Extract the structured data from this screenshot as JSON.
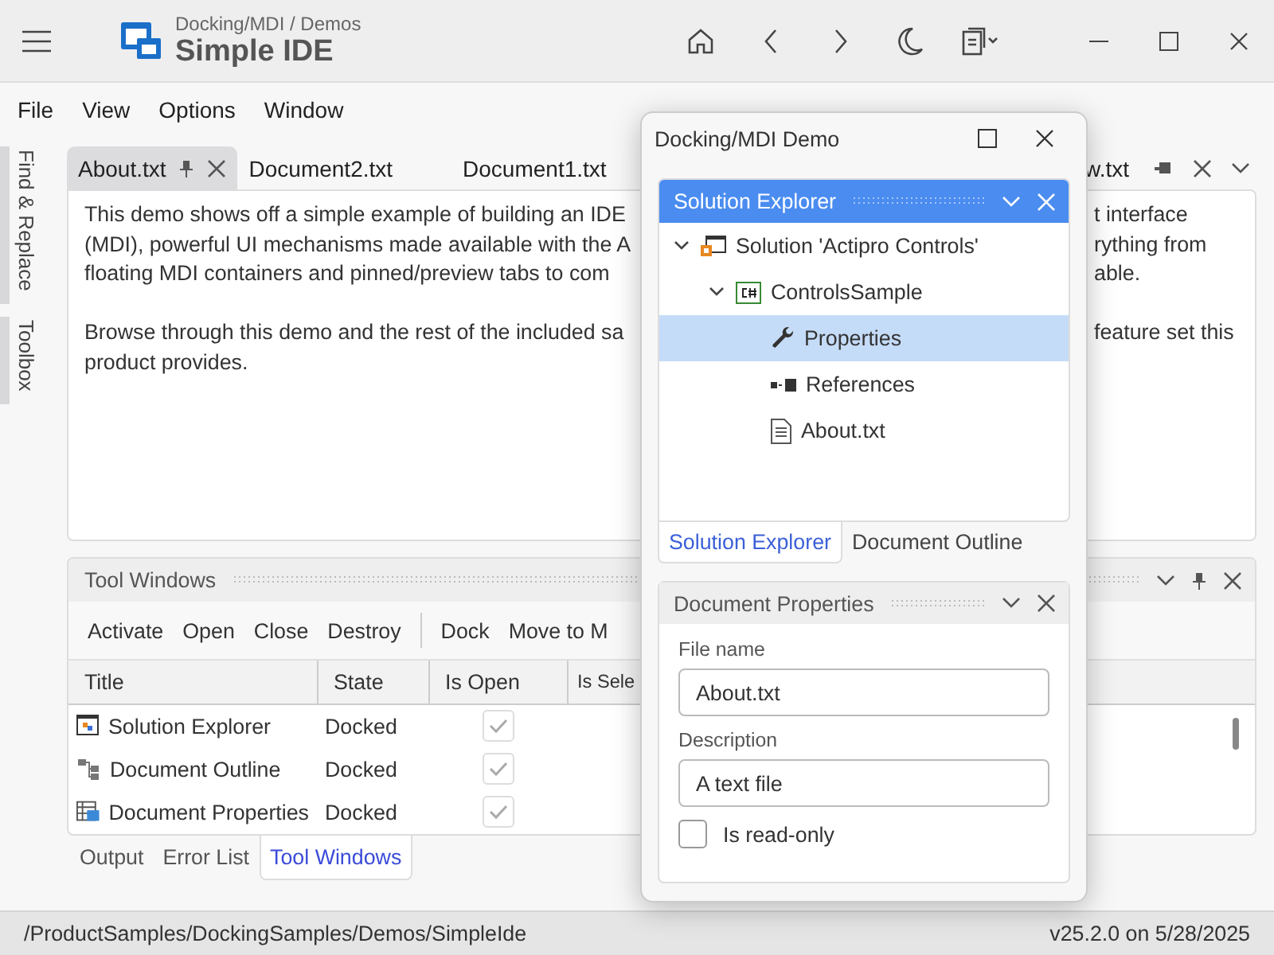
{
  "app": {
    "breadcrumb": "Docking/MDI / Demos",
    "title": "Simple IDE"
  },
  "menu": [
    "File",
    "View",
    "Options",
    "Window"
  ],
  "side_tabs": [
    "Find & Replace",
    "Toolbox"
  ],
  "document_tabs": [
    {
      "label": "About.txt",
      "selected": true
    },
    {
      "label": "Document2.txt",
      "selected": false
    },
    {
      "label": "Document1.txt",
      "selected": false
    },
    {
      "label": "w.txt",
      "selected": false
    }
  ],
  "document_text": {
    "left": [
      [
        "This demo shows off a simple example of building an IDE",
        "(MDI), powerful UI mechanisms made available with the A",
        "floating MDI containers and pinned/preview tabs to com"
      ],
      [
        "Browse through this demo and the rest of the included sa",
        "product provides."
      ]
    ],
    "right": [
      [
        "t interface",
        "rything from",
        "able."
      ],
      [
        "feature set this"
      ]
    ]
  },
  "tool_windows": {
    "title": "Tool Windows",
    "toolbar_groups": [
      [
        "Activate",
        "Open",
        "Close",
        "Destroy"
      ],
      [
        "Dock",
        "Move to M"
      ]
    ],
    "columns": [
      "Title",
      "State",
      "Is Open",
      "Is Sele"
    ],
    "rows": [
      {
        "kind": "solution",
        "title": "Solution Explorer",
        "state": "Docked",
        "is_open": true
      },
      {
        "kind": "outline",
        "title": "Document Outline",
        "state": "Docked",
        "is_open": true
      },
      {
        "kind": "properties",
        "title": "Document Properties",
        "state": "Docked",
        "is_open": true
      }
    ],
    "bottom_tabs": [
      {
        "label": "Output",
        "selected": false
      },
      {
        "label": "Error List",
        "selected": false
      },
      {
        "label": "Tool Windows",
        "selected": true
      }
    ]
  },
  "floating_window": {
    "title": "Docking/MDI Demo",
    "solution_explorer": {
      "title": "Solution Explorer",
      "tree": [
        {
          "kind": "solution",
          "label": "Solution 'Actipro Controls'",
          "expanded": true,
          "selected": false,
          "children": [
            {
              "kind": "project",
              "label": "ControlsSample",
              "expanded": true,
              "selected": false,
              "children": [
                {
                  "kind": "properties",
                  "label": "Properties",
                  "selected": true
                },
                {
                  "kind": "references",
                  "label": "References",
                  "selected": false
                },
                {
                  "kind": "file",
                  "label": "About.txt",
                  "selected": false
                }
              ]
            }
          ]
        }
      ]
    },
    "panel_tabs": [
      {
        "label": "Solution Explorer",
        "selected": true
      },
      {
        "label": "Document Outline",
        "selected": false
      }
    ],
    "properties": {
      "title": "Document Properties",
      "fields": [
        {
          "label": "File name",
          "value": "About.txt"
        },
        {
          "label": "Description",
          "value": "A text file"
        }
      ],
      "checkbox": {
        "label": "Is read-only",
        "checked": false
      }
    }
  },
  "status_bar": {
    "path": "/ProductSamples/DockingSamples/Demos/SimpleIde",
    "version": "v25.2.0 on 5/28/2025"
  }
}
